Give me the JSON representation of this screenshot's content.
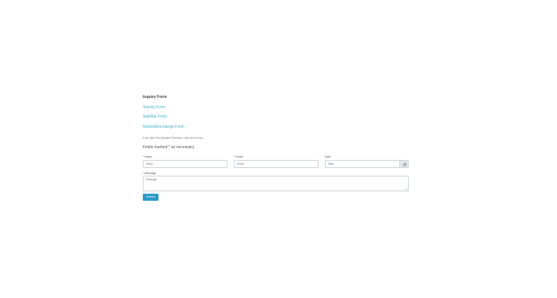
{
  "forms_nav": {
    "items": [
      {
        "label": "Inquiry Form",
        "active": true
      },
      {
        "label": "Survey Form",
        "active": false
      },
      {
        "label": "SideBar Form",
        "active": false
      },
      {
        "label": "Refund/Exchange Form",
        "active": false
      }
    ]
  },
  "note": "If you like Form Builder Extension, click here to buy",
  "legend": "Fields marked * as necessary",
  "fields": {
    "name": {
      "label": "Name",
      "placeholder": "Name",
      "required": true
    },
    "email": {
      "label": "Email",
      "placeholder": "Email",
      "required": true
    },
    "date": {
      "label": "Date",
      "placeholder": "Date",
      "required": false
    },
    "message": {
      "label": "Message",
      "placeholder": "Message",
      "required": true
    }
  },
  "required_marker": "*",
  "submit_label": "Submit",
  "colors": {
    "link": "#3ab0c8",
    "required": "#c0392b",
    "button": "#2c9ac9"
  }
}
